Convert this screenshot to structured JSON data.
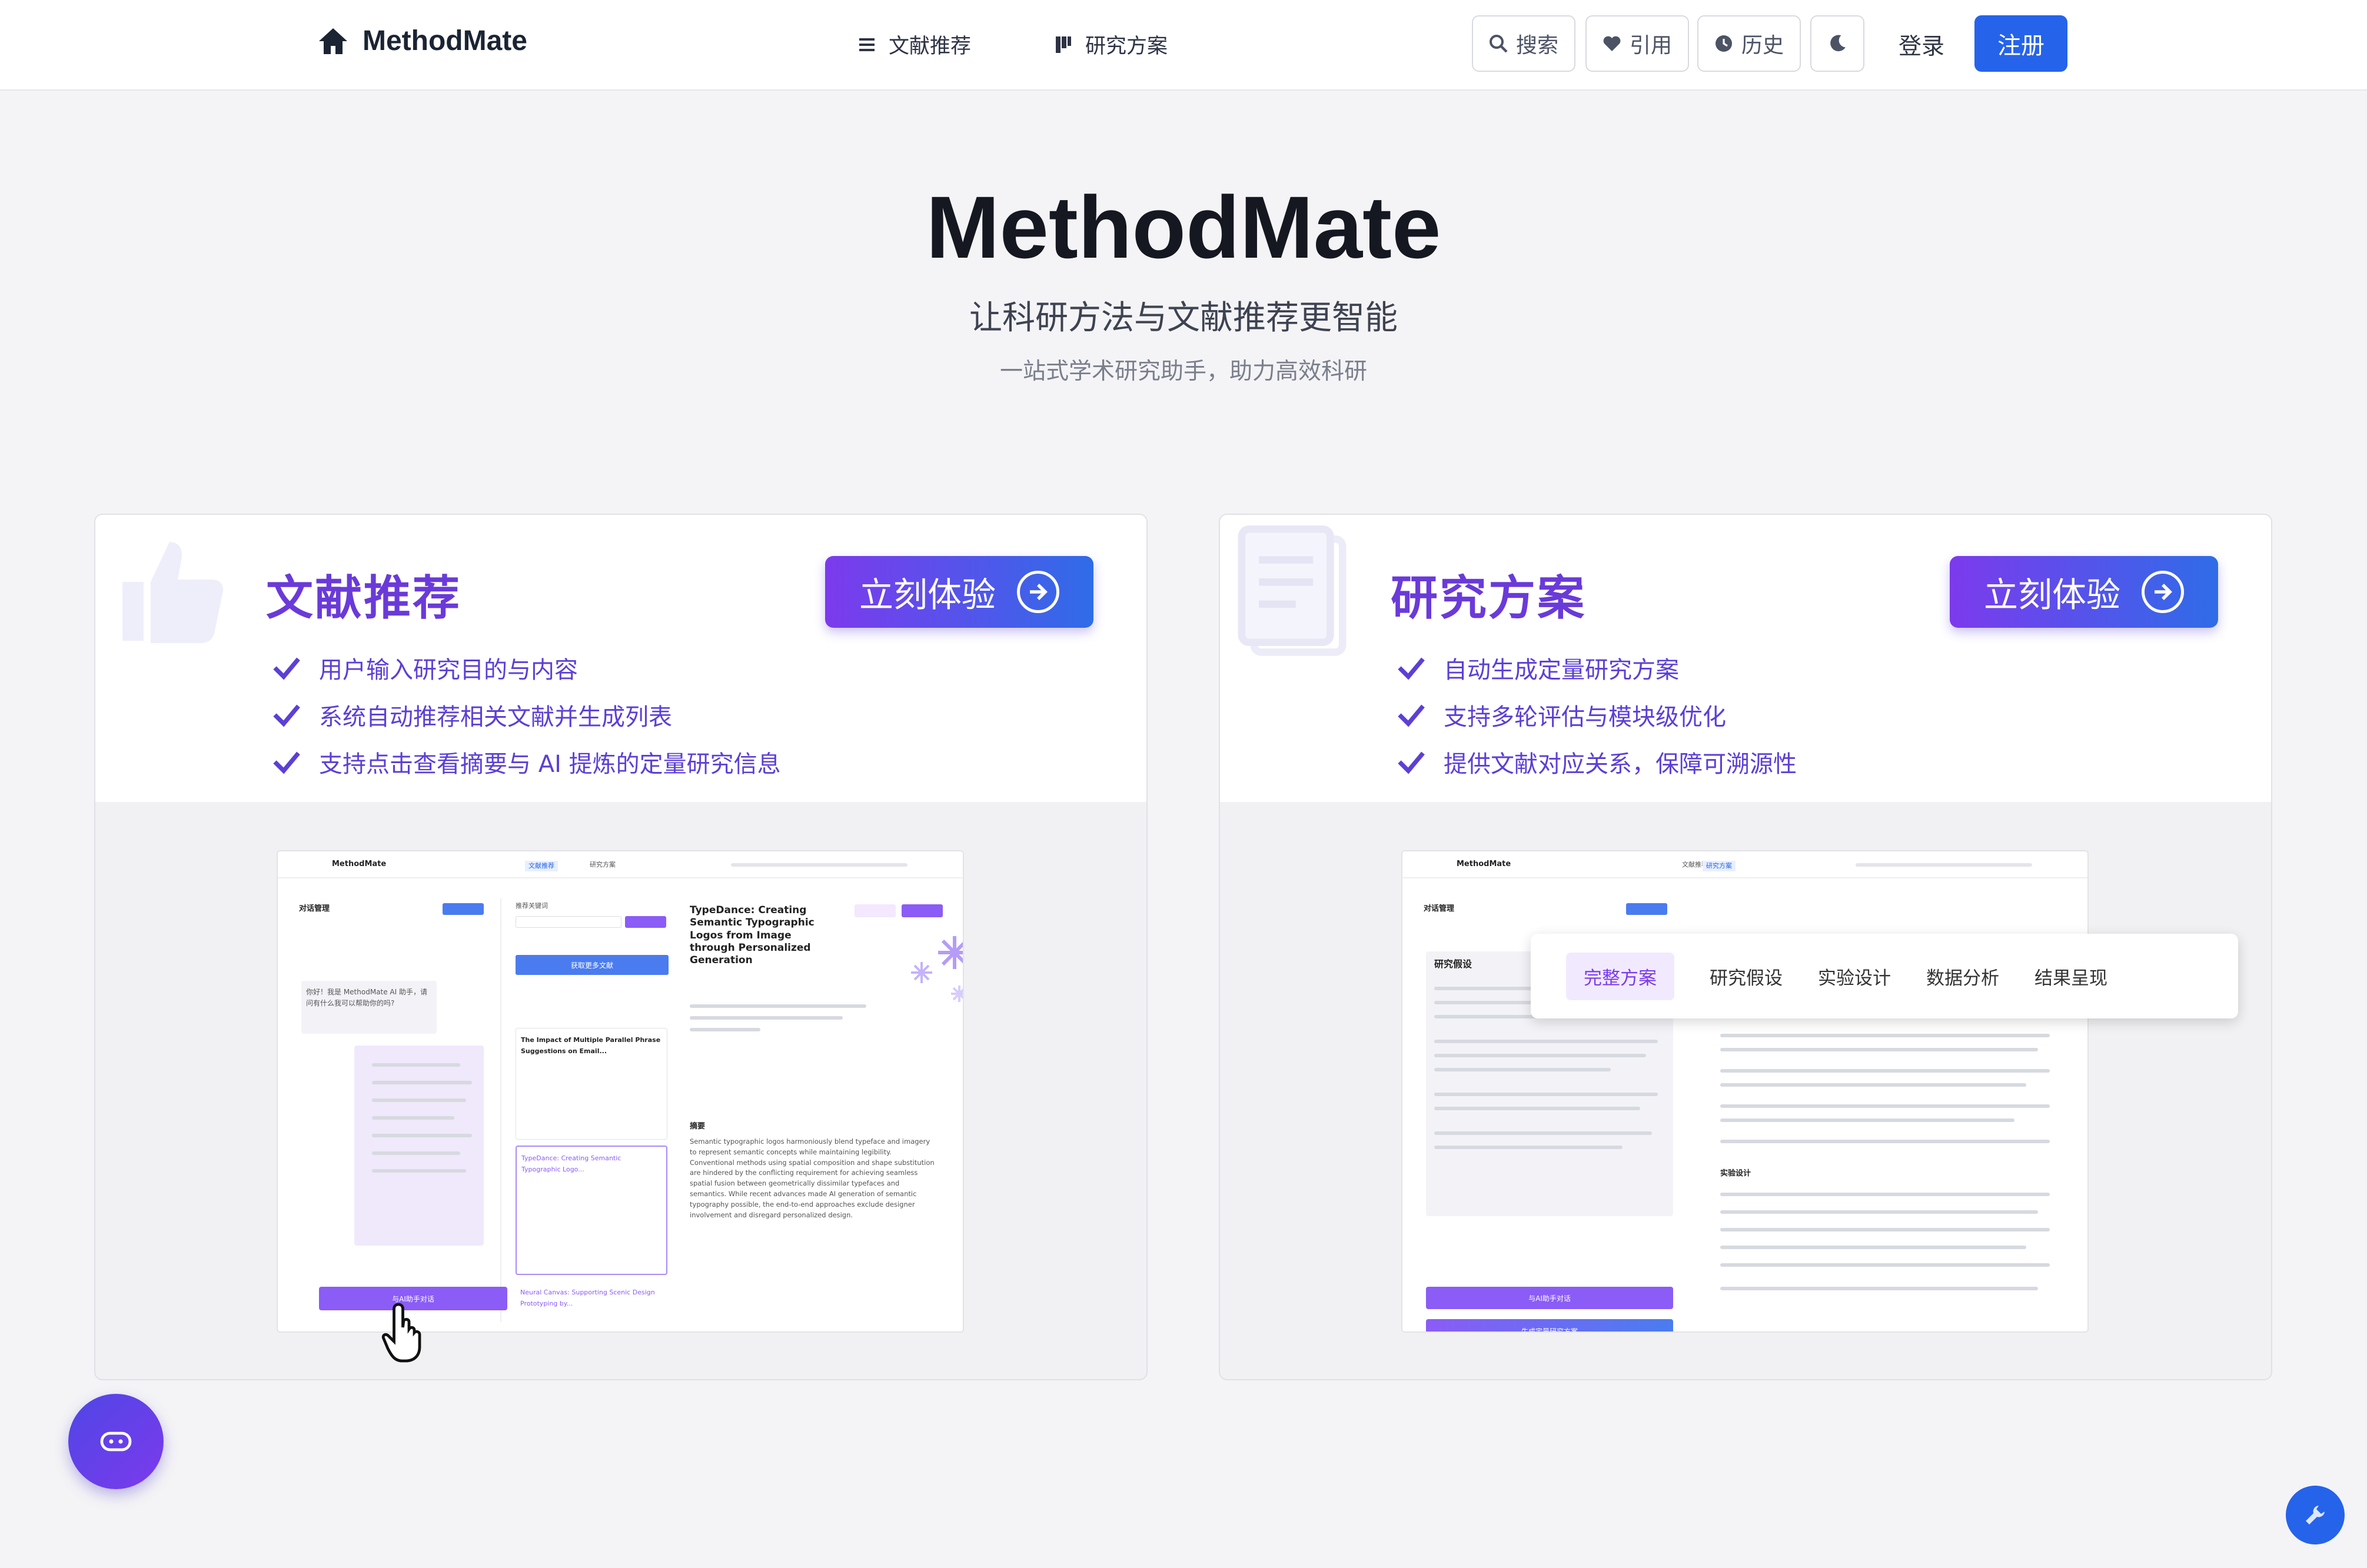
{
  "nav": {
    "brand": "MethodMate",
    "links": [
      "文献推荐",
      "研究方案"
    ],
    "tools": [
      "搜索",
      "引用",
      "历史"
    ],
    "login": "登录",
    "register": "注册"
  },
  "hero": {
    "title": "MethodMate",
    "subtitle": "让科研方法与文献推荐更智能",
    "description": "一站式学术研究助手，助力高效科研"
  },
  "cards": [
    {
      "title": "文献推荐",
      "button": "立刻体验",
      "features": [
        "用户输入研究目的与内容",
        "系统自动推荐相关文献并生成列表",
        "支持点击查看摘要与 AI 提炼的定量研究信息"
      ],
      "preview": {
        "brand": "MethodMate",
        "tabs": [
          "文献推荐",
          "研究方案"
        ],
        "panel_title": "对话管理",
        "greeting": "你好！我是 MethodMate AI 助手，请问有什么我可以帮助你的吗?",
        "list_title": "推荐关键词",
        "fetch_button": "获取更多文献",
        "paper_title": "TypeDance: Creating Semantic Typographic Logos from Image through Personalized Generation",
        "paper_list": [
          "The Impact of Multiple Parallel Phrase Suggestions on Email...",
          "TypeDance: Creating Semantic Typographic Logo...",
          "Neural Canvas: Supporting Scenic Design Prototyping by..."
        ],
        "abstract_title": "摘要",
        "abstract": "Semantic typographic logos harmoniously blend typeface and imagery to represent semantic concepts while maintaining legibility. Conventional methods using spatial composition and shape substitution are hindered by the conflicting requirement for achieving seamless spatial fusion between geometrically dissimilar typefaces and semantics. While recent advances made AI generation of semantic typography possible, the end-to-end approaches exclude designer involvement and disregard personalized design.",
        "chat_button": "与AI助手对话"
      }
    },
    {
      "title": "研究方案",
      "button": "立刻体验",
      "features": [
        "自动生成定量研究方案",
        "支持多轮评估与模块级优化",
        "提供文献对应关系，保障可溯源性"
      ],
      "preview": {
        "brand": "MethodMate",
        "tabs": [
          "文献推荐",
          "研究方案"
        ],
        "panel_title": "对话管理",
        "section": "研究假设",
        "plan_tabs": [
          "完整方案",
          "研究假设",
          "实验设计",
          "数据分析",
          "结果呈现"
        ],
        "design_title": "实验设计",
        "chat_button": "与AI助手对话",
        "generate_button": "生成定量研究方案"
      }
    }
  ],
  "colors": {
    "accent": "#2563eb",
    "purple": "#7c3aed",
    "title_purple": "#6a3ad9"
  }
}
